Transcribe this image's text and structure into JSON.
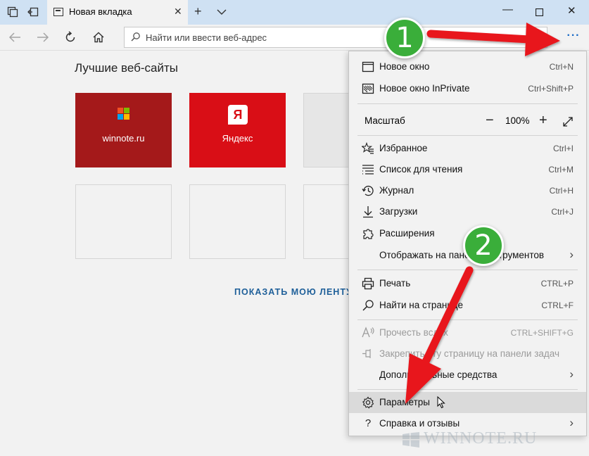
{
  "browser": {
    "tab_title": "Новая вкладка",
    "address_placeholder": "Найти или ввести веб-адрес"
  },
  "content": {
    "section_title": "Лучшие веб-сайты",
    "tiles": [
      {
        "label": "winnote.ru"
      },
      {
        "label": "Яндекс",
        "logo_text": "Я"
      }
    ],
    "feed_link": "ПОКАЗАТЬ МОЮ ЛЕНТУ"
  },
  "menu": {
    "new_window": {
      "label": "Новое окно",
      "shortcut": "Ctrl+N"
    },
    "new_private": {
      "label": "Новое окно InPrivate",
      "shortcut": "Ctrl+Shift+P"
    },
    "zoom": {
      "label": "Масштаб",
      "value": "100%"
    },
    "favorites": {
      "label": "Избранное",
      "shortcut": "Ctrl+I"
    },
    "reading_list": {
      "label": "Список для чтения",
      "shortcut": "Ctrl+M"
    },
    "history": {
      "label": "Журнал",
      "shortcut": "Ctrl+H"
    },
    "downloads": {
      "label": "Загрузки",
      "shortcut": "Ctrl+J"
    },
    "extensions": {
      "label": "Расширения"
    },
    "toolbar": {
      "label": "Отображать на панели инструментов"
    },
    "print": {
      "label": "Печать",
      "shortcut": "CTRL+P"
    },
    "find": {
      "label": "Найти на странице",
      "shortcut": "CTRL+F"
    },
    "read_aloud": {
      "label": "Прочесть вслух",
      "shortcut": "CTRL+SHIFT+G"
    },
    "pin": {
      "label": "Закрепить эту страницу на панели задач"
    },
    "more_tools": {
      "label": "Дополнительные средства"
    },
    "settings": {
      "label": "Параметры"
    },
    "help": {
      "label": "Справка и отзывы"
    }
  },
  "annotations": {
    "badge1": "1",
    "badge2": "2"
  },
  "watermark": "WINNOTE.RU",
  "colors": {
    "titlebar": "#cfe1f3",
    "tile_winnote": "#a4191a",
    "tile_yandex": "#d90e16",
    "accent_blue": "#1769c6",
    "annotation_green": "#3aae3a",
    "annotation_arrow": "#e8141b"
  }
}
